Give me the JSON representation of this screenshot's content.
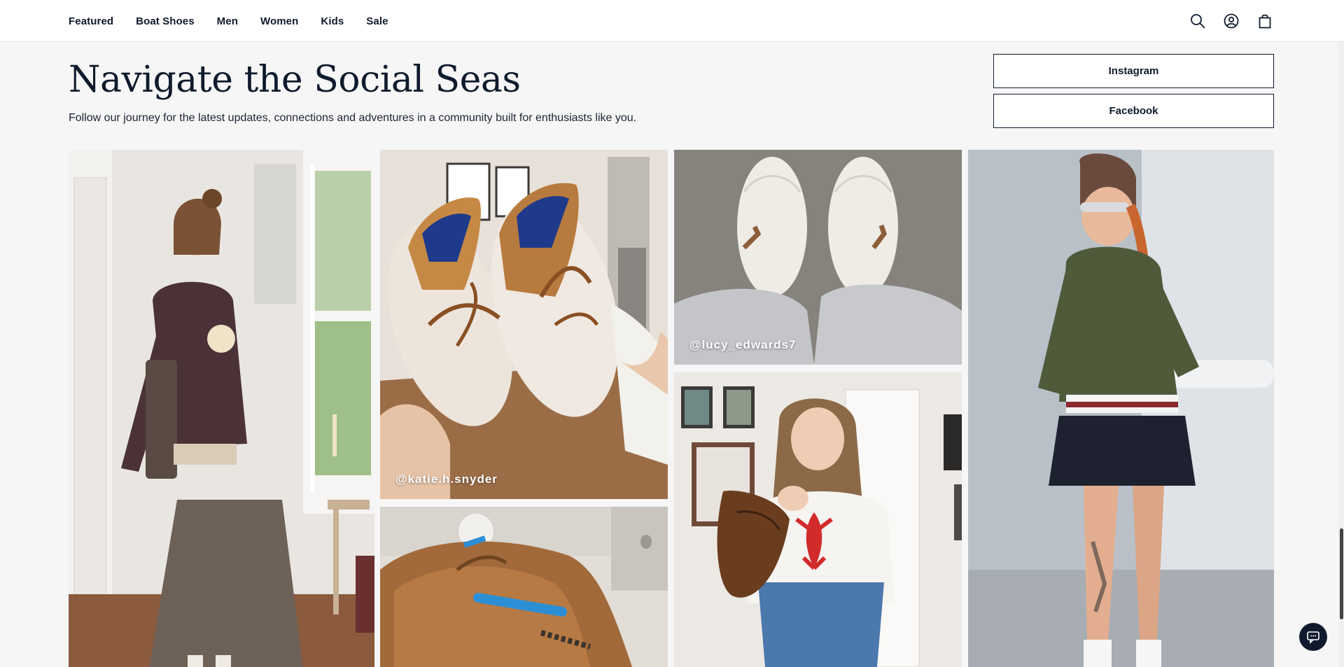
{
  "nav": {
    "items": [
      {
        "label": "Featured"
      },
      {
        "label": "Boat Shoes"
      },
      {
        "label": "Men"
      },
      {
        "label": "Women"
      },
      {
        "label": "Kids"
      },
      {
        "label": "Sale"
      }
    ],
    "icons": [
      "search-icon",
      "account-icon",
      "cart-icon"
    ]
  },
  "section": {
    "title": "Navigate the Social Seas",
    "subtitle": "Follow our journey for the latest updates, connections and adventures in a community built for enthusiasts like you."
  },
  "social": {
    "instagram_label": "Instagram",
    "facebook_label": "Facebook"
  },
  "gallery": {
    "tiles": [
      {
        "handle": ""
      },
      {
        "handle": "@katie.h.snyder"
      },
      {
        "handle": ""
      },
      {
        "handle": "@lucy_edwards7"
      },
      {
        "handle": ""
      },
      {
        "handle": ""
      }
    ]
  },
  "chat": {
    "icon": "chat-icon"
  },
  "colors": {
    "brand_navy": "#0f1b2d",
    "page_bg": "#f6f6f6"
  }
}
